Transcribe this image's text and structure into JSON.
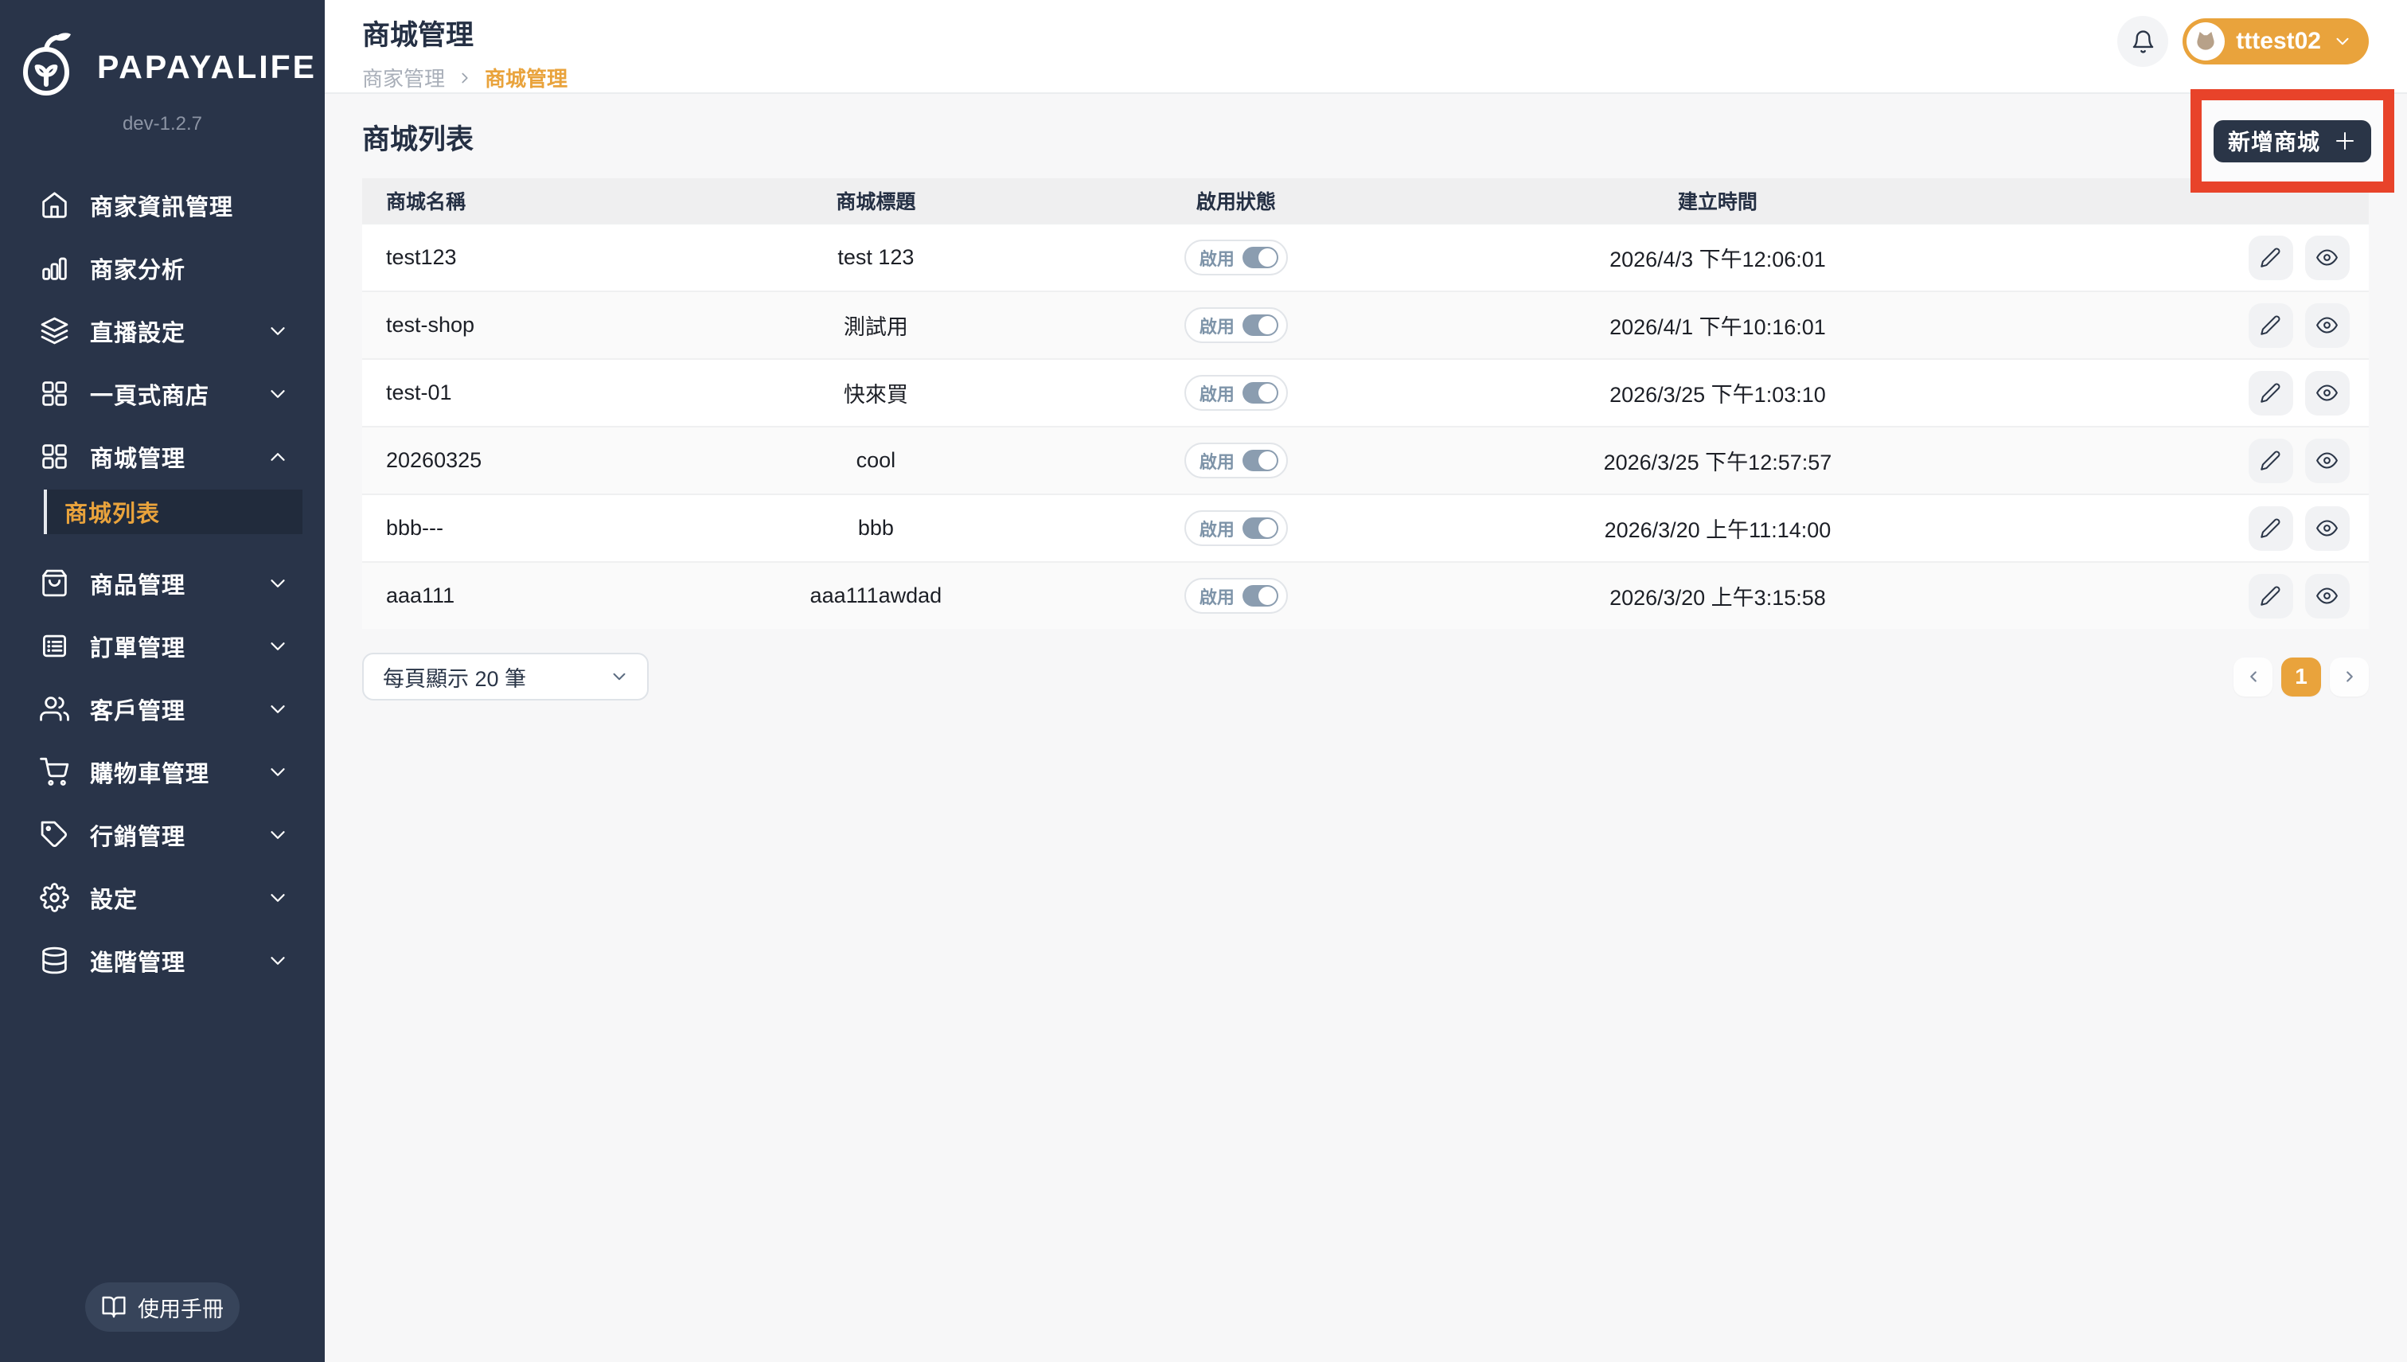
{
  "app": {
    "name": "PAPAYALIFE",
    "version": "dev-1.2.7"
  },
  "colors": {
    "accent": "#E9A33C",
    "sidebar": "#293449",
    "annotation_highlight": "#E8432A",
    "toggle_track": "#8B9DB0",
    "content_bg": "#F7F7F8"
  },
  "sidebar": {
    "items": [
      {
        "id": "merchant-info",
        "label": "商家資訊管理",
        "icon": "home-icon"
      },
      {
        "id": "merchant-analytics",
        "label": "商家分析",
        "icon": "bar-chart-icon"
      },
      {
        "id": "live-settings",
        "label": "直播設定",
        "icon": "layers-icon",
        "expand": "down"
      },
      {
        "id": "one-page-shop",
        "label": "一頁式商店",
        "icon": "grid-icon",
        "expand": "down"
      },
      {
        "id": "mall-management",
        "label": "商城管理",
        "icon": "grid-icon",
        "expand": "up",
        "children": [
          {
            "id": "mall-list",
            "label": "商城列表",
            "active": true
          }
        ]
      },
      {
        "id": "product-management",
        "label": "商品管理",
        "icon": "shopping-bag-icon",
        "expand": "down"
      },
      {
        "id": "order-management",
        "label": "訂單管理",
        "icon": "order-list-icon",
        "expand": "down"
      },
      {
        "id": "customer-management",
        "label": "客戶管理",
        "icon": "users-icon",
        "expand": "down"
      },
      {
        "id": "cart-management",
        "label": "購物車管理",
        "icon": "cart-icon",
        "expand": "down"
      },
      {
        "id": "marketing-management",
        "label": "行銷管理",
        "icon": "tag-icon",
        "expand": "down"
      },
      {
        "id": "settings",
        "label": "設定",
        "icon": "gear-icon",
        "expand": "down"
      },
      {
        "id": "advanced-management",
        "label": "進階管理",
        "icon": "database-icon",
        "expand": "down"
      }
    ],
    "manual_label": "使用手冊"
  },
  "header": {
    "title": "商城管理",
    "breadcrumb": [
      "商家管理",
      "商城管理"
    ],
    "user": {
      "name": "tttest02"
    }
  },
  "content": {
    "section_title": "商城列表",
    "add_button_label": "新增商城",
    "table": {
      "columns": [
        "商城名稱",
        "商城標題",
        "啟用狀態",
        "建立時間"
      ],
      "toggle_label": "啟用",
      "rows": [
        {
          "name": "test123",
          "title": "test 123",
          "enabled": true,
          "created": "2026/4/3 下午12:06:01"
        },
        {
          "name": "test-shop",
          "title": "測試用",
          "enabled": true,
          "created": "2026/4/1 下午10:16:01"
        },
        {
          "name": "test-01",
          "title": "快來買",
          "enabled": true,
          "created": "2026/3/25 下午1:03:10"
        },
        {
          "name": "20260325",
          "title": "cool",
          "enabled": true,
          "created": "2026/3/25 下午12:57:57"
        },
        {
          "name": "bbb---",
          "title": "bbb",
          "enabled": true,
          "created": "2026/3/20 上午11:14:00"
        },
        {
          "name": "aaa111",
          "title": "aaa111awdad",
          "enabled": true,
          "created": "2026/3/20 上午3:15:58"
        }
      ]
    },
    "pagination": {
      "page_size_label": "每頁顯示 20 筆",
      "current_page": "1"
    }
  }
}
